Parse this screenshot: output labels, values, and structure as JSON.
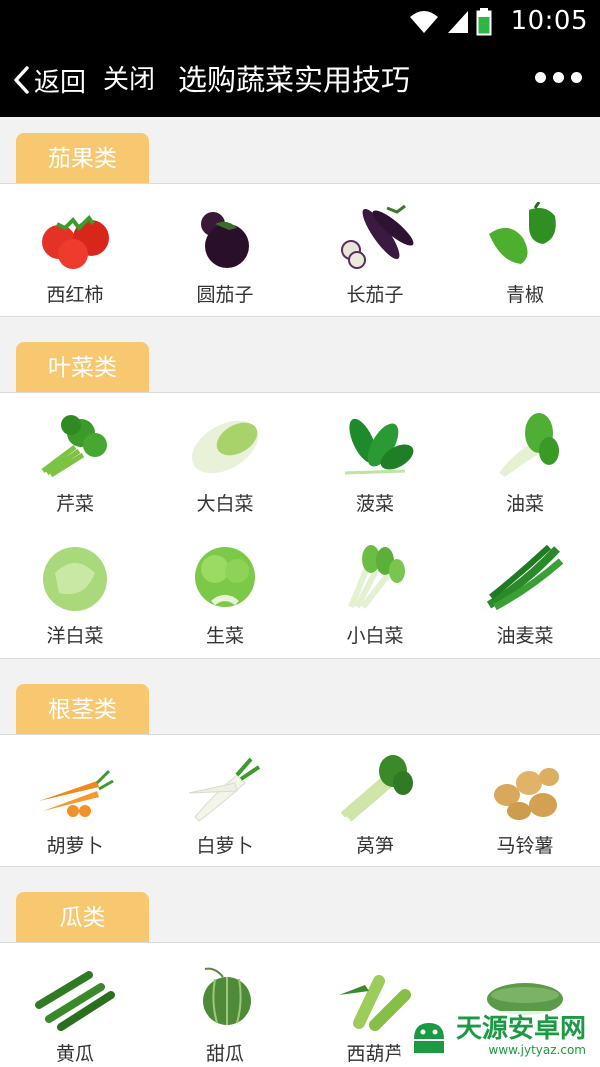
{
  "status": {
    "time": "10:05"
  },
  "nav": {
    "back_label": "返回",
    "close_label": "关闭",
    "title": "选购蔬菜实用技巧"
  },
  "sections": [
    {
      "title": "茄果类",
      "items": [
        {
          "label": "西红柿",
          "icon": "tomato-icon"
        },
        {
          "label": "圆茄子",
          "icon": "round-eggplant-icon"
        },
        {
          "label": "长茄子",
          "icon": "long-eggplant-icon"
        },
        {
          "label": "青椒",
          "icon": "green-pepper-icon"
        }
      ]
    },
    {
      "title": "叶菜类",
      "items": [
        {
          "label": "芹菜",
          "icon": "celery-icon"
        },
        {
          "label": "大白菜",
          "icon": "napa-cabbage-icon"
        },
        {
          "label": "菠菜",
          "icon": "spinach-icon"
        },
        {
          "label": "油菜",
          "icon": "bok-choy-icon"
        },
        {
          "label": "洋白菜",
          "icon": "cabbage-icon"
        },
        {
          "label": "生菜",
          "icon": "lettuce-icon"
        },
        {
          "label": "小白菜",
          "icon": "baby-bok-choy-icon"
        },
        {
          "label": "油麦菜",
          "icon": "indian-lettuce-icon"
        }
      ]
    },
    {
      "title": "根茎类",
      "items": [
        {
          "label": "胡萝卜",
          "icon": "carrot-icon"
        },
        {
          "label": "白萝卜",
          "icon": "white-radish-icon"
        },
        {
          "label": "莴笋",
          "icon": "celtuce-icon"
        },
        {
          "label": "马铃薯",
          "icon": "potato-icon"
        }
      ]
    },
    {
      "title": "瓜类",
      "items": [
        {
          "label": "黄瓜",
          "icon": "cucumber-icon"
        },
        {
          "label": "甜瓜",
          "icon": "melon-icon"
        },
        {
          "label": "西葫芦",
          "icon": "zucchini-icon"
        },
        {
          "label": "",
          "icon": "winter-melon-icon"
        }
      ]
    }
  ],
  "watermark": {
    "text": "天源安卓网",
    "url": "www.jytyaz.com"
  },
  "colors": {
    "tab": "#f7c870",
    "bar": "#000000",
    "background": "#f2f2f2",
    "brand": "#1b9a43"
  }
}
